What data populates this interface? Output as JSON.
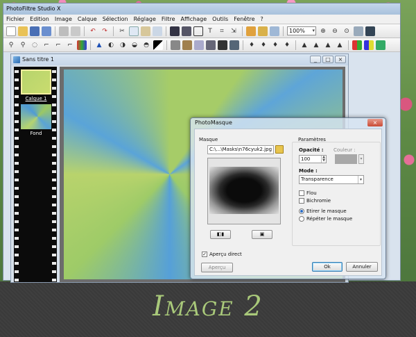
{
  "caption": "Image 2",
  "app": {
    "title": "PhotoFiltre Studio X",
    "menu": [
      "Fichier",
      "Edition",
      "Image",
      "Calque",
      "Sélection",
      "Réglage",
      "Filtre",
      "Affichage",
      "Outils",
      "Fenêtre",
      "?"
    ],
    "zoom": "100%"
  },
  "document": {
    "title": "Sans titre 1",
    "window_controls": [
      "_",
      "□",
      "×"
    ],
    "layers": [
      {
        "label": "Calque 1"
      },
      {
        "label": "Fond"
      }
    ]
  },
  "dialog": {
    "title": "PhotoMasque",
    "close": "×",
    "masque_label": "Masque",
    "mask_path": "C:\\...\\Masks\\n76cyuk2.jpg",
    "parametres_label": "Paramètres",
    "opacity_label": "Opacité :",
    "opacity_value": "100",
    "couleur_label": "Couleur :",
    "mode_label": "Mode :",
    "mode_value": "Transparence",
    "flou_label": "Flou",
    "bichromie_label": "Bichromie",
    "etirer_label": "Etirer le masque",
    "repeter_label": "Répéter le masque",
    "apercu_direct_label": "Aperçu direct",
    "apercu_button": "Aperçu",
    "ok_button": "Ok",
    "annuler_button": "Annuler",
    "apercu_direct_checked": true,
    "flou_checked": false,
    "bichromie_checked": false,
    "selected_mask_mode": "etirer"
  }
}
